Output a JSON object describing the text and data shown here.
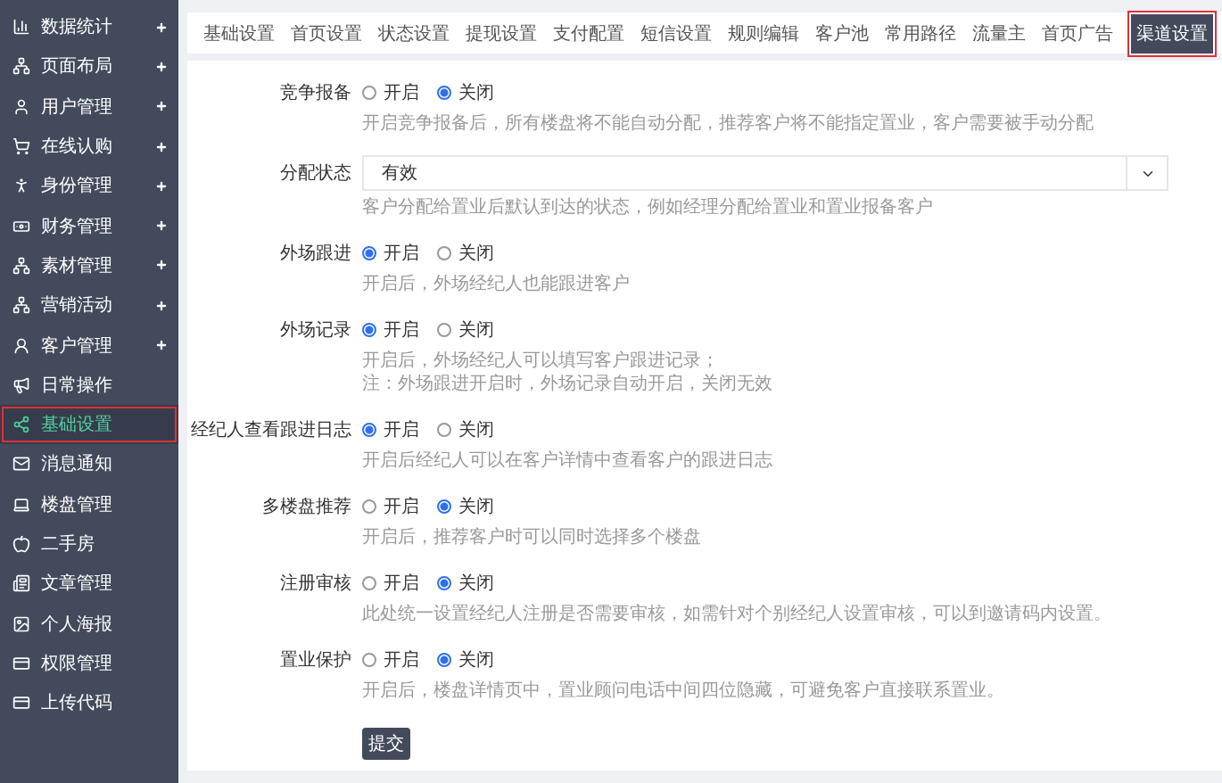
{
  "sidebar": {
    "items": [
      {
        "label": "数据统计",
        "expandable": true,
        "selected": false
      },
      {
        "label": "页面布局",
        "expandable": true,
        "selected": false
      },
      {
        "label": "用户管理",
        "expandable": true,
        "selected": false
      },
      {
        "label": "在线认购",
        "expandable": true,
        "selected": false
      },
      {
        "label": "身份管理",
        "expandable": true,
        "selected": false
      },
      {
        "label": "财务管理",
        "expandable": true,
        "selected": false
      },
      {
        "label": "素材管理",
        "expandable": true,
        "selected": false
      },
      {
        "label": "营销活动",
        "expandable": true,
        "selected": false
      },
      {
        "label": "客户管理",
        "expandable": true,
        "selected": false
      },
      {
        "label": "日常操作",
        "expandable": false,
        "selected": false
      },
      {
        "label": "基础设置",
        "expandable": false,
        "selected": true
      },
      {
        "label": "消息通知",
        "expandable": false,
        "selected": false
      },
      {
        "label": "楼盘管理",
        "expandable": false,
        "selected": false
      },
      {
        "label": "二手房",
        "expandable": false,
        "selected": false
      },
      {
        "label": "文章管理",
        "expandable": false,
        "selected": false
      },
      {
        "label": "个人海报",
        "expandable": false,
        "selected": false
      },
      {
        "label": "权限管理",
        "expandable": false,
        "selected": false
      },
      {
        "label": "上传代码",
        "expandable": false,
        "selected": false
      }
    ]
  },
  "tabs": [
    {
      "label": "基础设置",
      "selected": false
    },
    {
      "label": "首页设置",
      "selected": false
    },
    {
      "label": "状态设置",
      "selected": false
    },
    {
      "label": "提现设置",
      "selected": false
    },
    {
      "label": "支付配置",
      "selected": false
    },
    {
      "label": "短信设置",
      "selected": false
    },
    {
      "label": "规则编辑",
      "selected": false
    },
    {
      "label": "客户池",
      "selected": false
    },
    {
      "label": "常用路径",
      "selected": false
    },
    {
      "label": "流量主",
      "selected": false
    },
    {
      "label": "首页广告",
      "selected": false
    },
    {
      "label": "渠道设置",
      "selected": true
    }
  ],
  "form": {
    "fields": [
      {
        "kind": "radio",
        "label": "竞争报备",
        "options": [
          {
            "label": "开启",
            "selected": false
          },
          {
            "label": "关闭",
            "selected": true
          }
        ],
        "help": [
          "开启竞争报备后，所有楼盘将不能自动分配，推荐客户将不能指定置业，客户需要被手动分配"
        ]
      },
      {
        "kind": "select",
        "label": "分配状态",
        "value": "有效",
        "help": [
          "客户分配给置业后默认到达的状态，例如经理分配给置业和置业报备客户"
        ]
      },
      {
        "kind": "radio",
        "label": "外场跟进",
        "options": [
          {
            "label": "开启",
            "selected": true
          },
          {
            "label": "关闭",
            "selected": false
          }
        ],
        "help": [
          "开启后，外场经纪人也能跟进客户"
        ]
      },
      {
        "kind": "radio",
        "label": "外场记录",
        "options": [
          {
            "label": "开启",
            "selected": true
          },
          {
            "label": "关闭",
            "selected": false
          }
        ],
        "help": [
          "开启后，外场经纪人可以填写客户跟进记录；",
          "注：外场跟进开启时，外场记录自动开启，关闭无效"
        ]
      },
      {
        "kind": "radio",
        "label": "经纪人查看跟进日志",
        "options": [
          {
            "label": "开启",
            "selected": true
          },
          {
            "label": "关闭",
            "selected": false
          }
        ],
        "help": [
          "开启后经纪人可以在客户详情中查看客户的跟进日志"
        ]
      },
      {
        "kind": "radio",
        "label": "多楼盘推荐",
        "options": [
          {
            "label": "开启",
            "selected": false
          },
          {
            "label": "关闭",
            "selected": true
          }
        ],
        "help": [
          "开启后，推荐客户时可以同时选择多个楼盘"
        ]
      },
      {
        "kind": "radio",
        "label": "注册审核",
        "options": [
          {
            "label": "开启",
            "selected": false
          },
          {
            "label": "关闭",
            "selected": true
          }
        ],
        "help": [
          "此处统一设置经纪人注册是否需要审核，如需针对个别经纪人设置审核，可以到邀请码内设置。"
        ]
      },
      {
        "kind": "radio",
        "label": "置业保护",
        "options": [
          {
            "label": "开启",
            "selected": false
          },
          {
            "label": "关闭",
            "selected": true
          }
        ],
        "help": [
          "开启后，楼盘详情页中，置业顾问电话中间四位隐藏，可避免客户直接联系置业。"
        ]
      }
    ],
    "submit": "提交"
  }
}
